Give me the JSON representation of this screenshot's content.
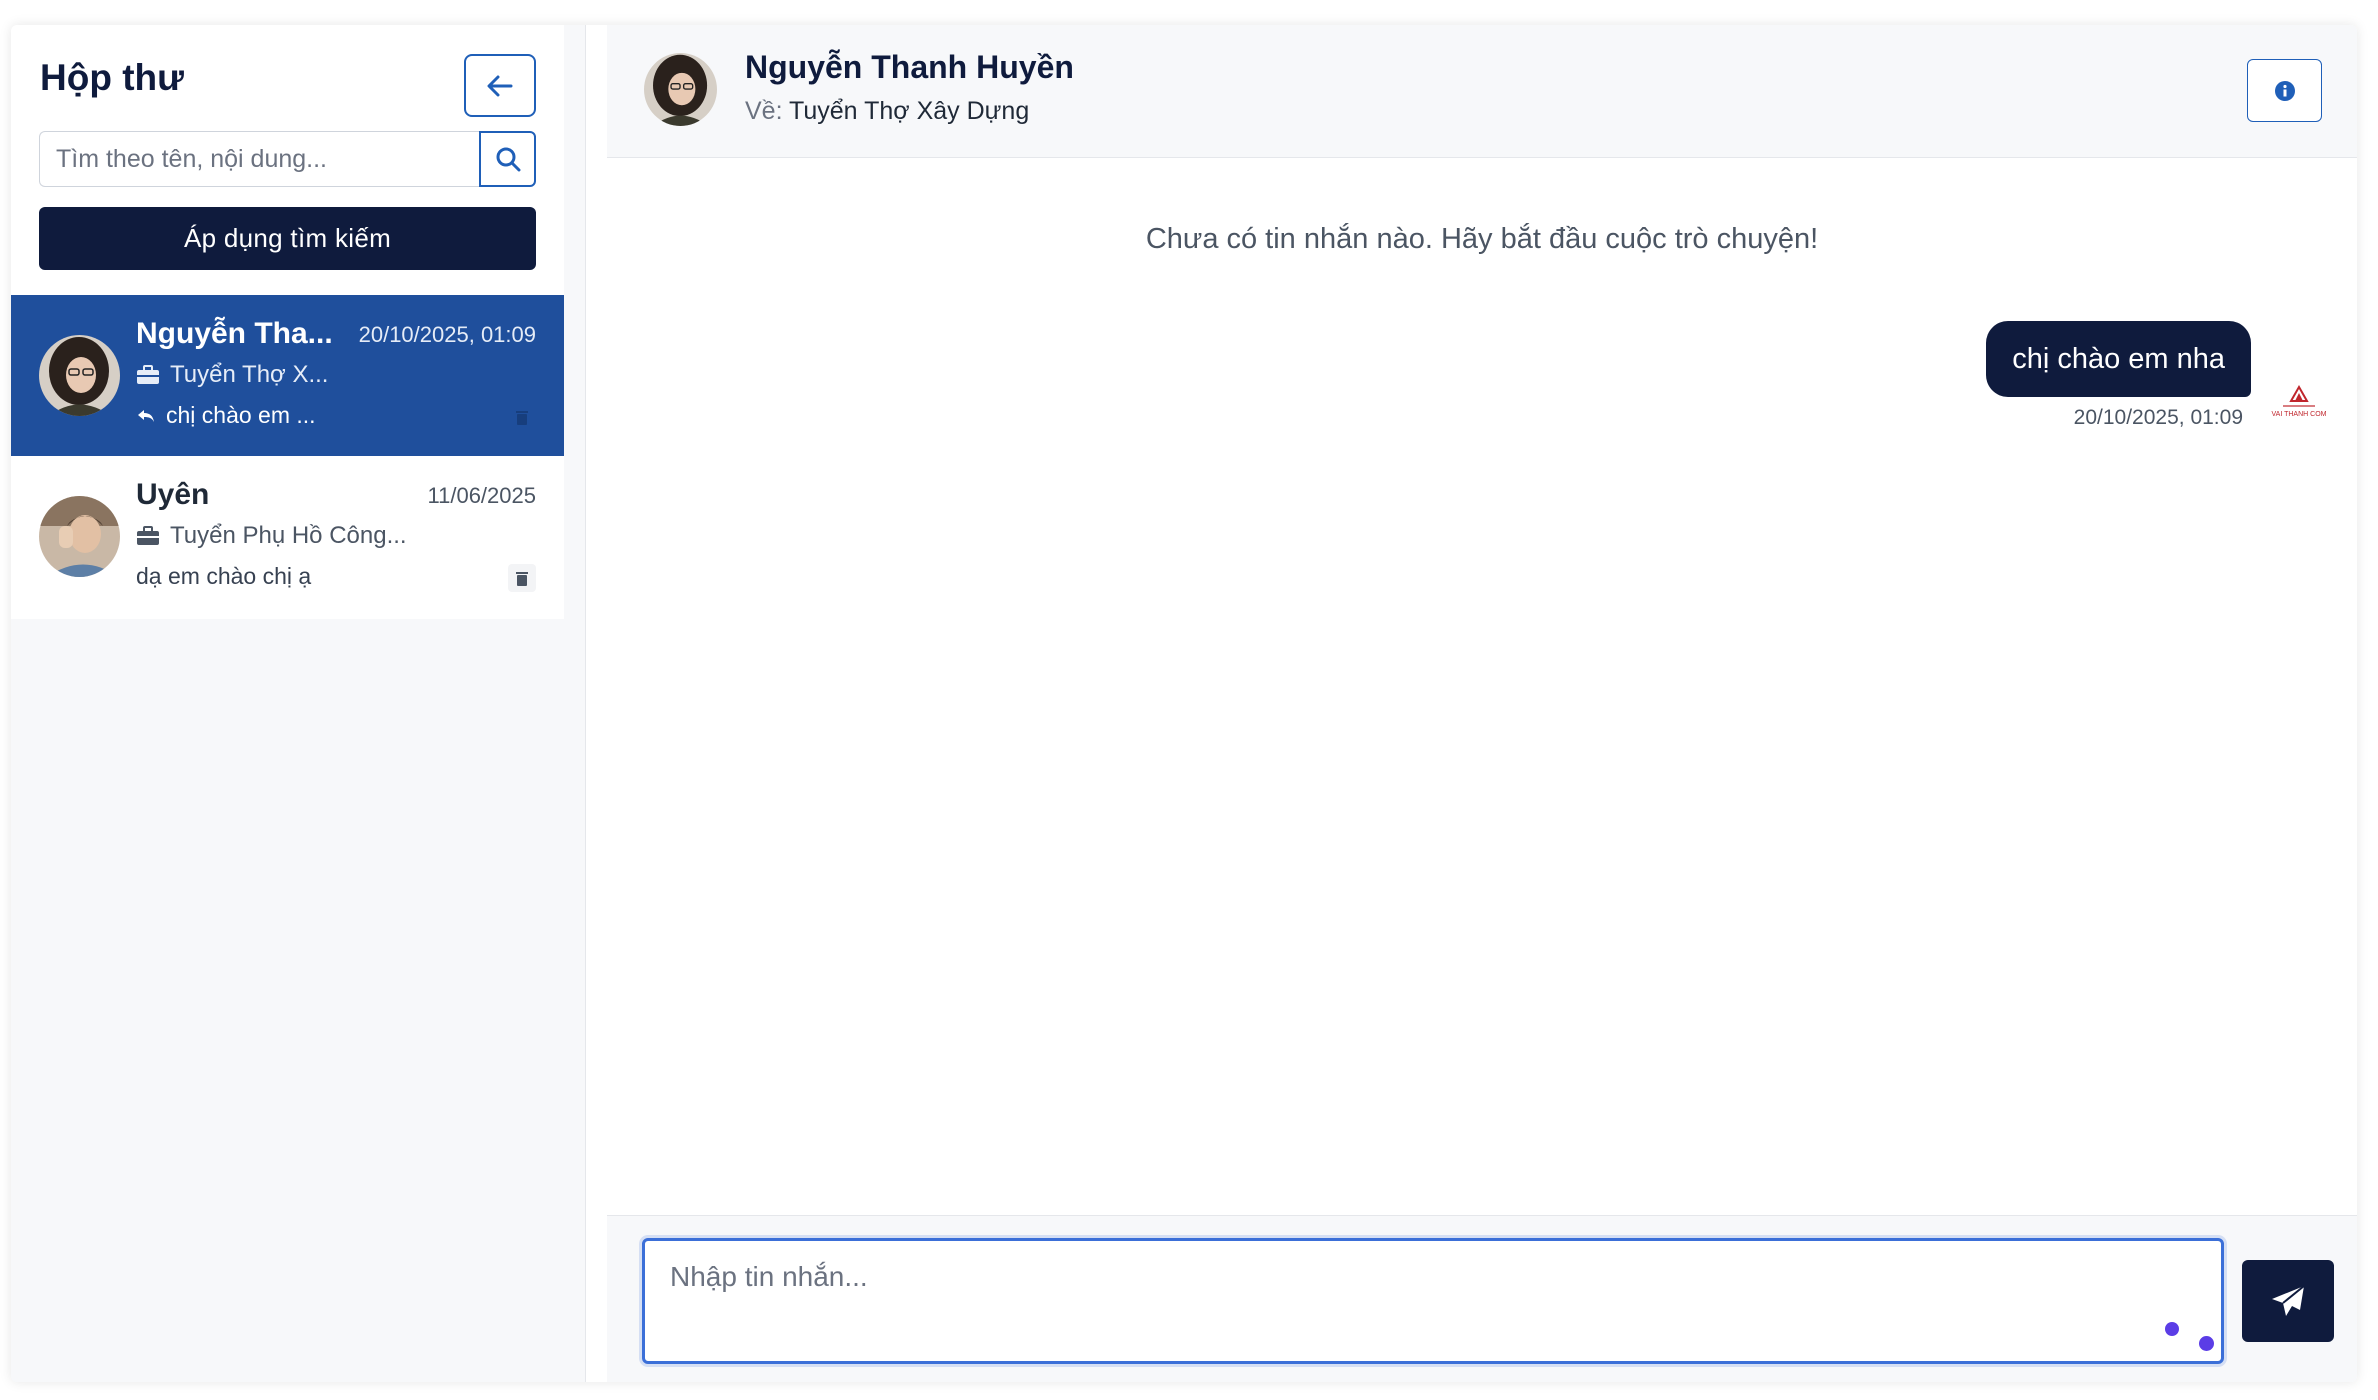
{
  "sidebar": {
    "title": "Hộp thư",
    "search_placeholder": "Tìm theo tên, nội dung...",
    "apply_label": "Áp dụng tìm kiếm",
    "conversations": [
      {
        "name": "Nguyễn Tha...",
        "time": "20/10/2025, 01:09",
        "job": "Tuyển Thợ X...",
        "last_message": "chị chào em ...",
        "active": true
      },
      {
        "name": "Uyên",
        "time": "11/06/2025",
        "job": "Tuyển Phụ Hồ Công...",
        "last_message": "dạ em chào chị ạ",
        "active": false
      }
    ]
  },
  "chat": {
    "header": {
      "name": "Nguyễn Thanh Huyền",
      "about_label": "Về:",
      "job_title": "Tuyển Thợ Xây Dựng"
    },
    "empty_text": "Chưa có tin nhắn nào. Hãy bắt đầu cuộc trò chuyện!",
    "messages": [
      {
        "text": "chị chào em nha",
        "time": "20/10/2025, 01:09",
        "sender_logo": "VAI THANH COM"
      }
    ],
    "composer_placeholder": "Nhập tin nhắn..."
  },
  "icons": {
    "back": "arrow-left-icon",
    "search": "search-icon",
    "job": "briefcase-icon",
    "reply": "reply-icon",
    "delete": "trash-icon",
    "info": "info-icon",
    "send": "paper-plane-icon"
  },
  "colors": {
    "navy": "#0f1b3d",
    "active_row": "#1f4f9c",
    "accent_blue": "#1f5fb8",
    "input_focus": "#3b6fd8",
    "dot_purple": "#5b3de6"
  }
}
